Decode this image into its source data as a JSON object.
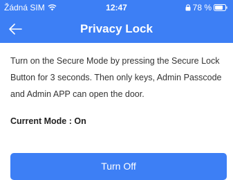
{
  "status_bar": {
    "carrier": "Žádná SIM",
    "time": "12:47",
    "battery": "78 %",
    "icons": [
      "wifi-icon",
      "lock-icon",
      "battery-icon"
    ]
  },
  "nav": {
    "title": "Privacy Lock",
    "back_icon": "arrow-left-icon"
  },
  "content": {
    "description": "Turn on the Secure Mode by pressing the Secure Lock Button for 3 seconds. Then only keys, Admin Passcode and Admin APP can open the door.",
    "current_mode": "Current Mode : On"
  },
  "actions": {
    "turn_off_label": "Turn Off"
  },
  "colors": {
    "accent": "#3d7ff5"
  }
}
